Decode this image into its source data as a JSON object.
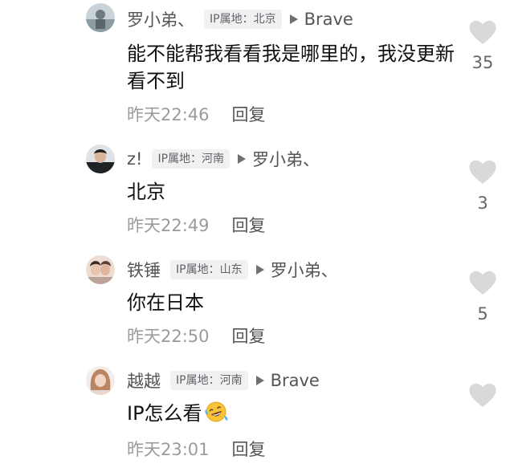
{
  "comments": [
    {
      "author": "罗小弟、",
      "ip": "IP属地：北京",
      "reply_to": "Brave",
      "text": "能不能帮我看看我是哪里的，我没更新看不到",
      "time": "昨天22:46",
      "reply_label": "回复",
      "likes": "35"
    },
    {
      "author": "z!",
      "ip": "IP属地：河南",
      "reply_to": "罗小弟、",
      "text": "北京",
      "time": "昨天22:49",
      "reply_label": "回复",
      "likes": "3"
    },
    {
      "author": "铁锤",
      "ip": "IP属地：山东",
      "reply_to": "罗小弟、",
      "text": "你在日本",
      "time": "昨天22:50",
      "reply_label": "回复",
      "likes": "5"
    },
    {
      "author": "越越",
      "ip": "IP属地：河南",
      "reply_to": "Brave",
      "text": "IP怎么看",
      "time": "昨天23:01",
      "reply_label": "回复",
      "likes": ""
    }
  ],
  "icons": {
    "like": "heart-icon",
    "reply_arrow": "triangle-right-icon",
    "emoji": "laughing-tears-emoji"
  },
  "colors": {
    "like_heart": "#d9d9d9",
    "ip_badge_bg": "#f1f1f2",
    "meta_text": "#9b9b9b"
  }
}
